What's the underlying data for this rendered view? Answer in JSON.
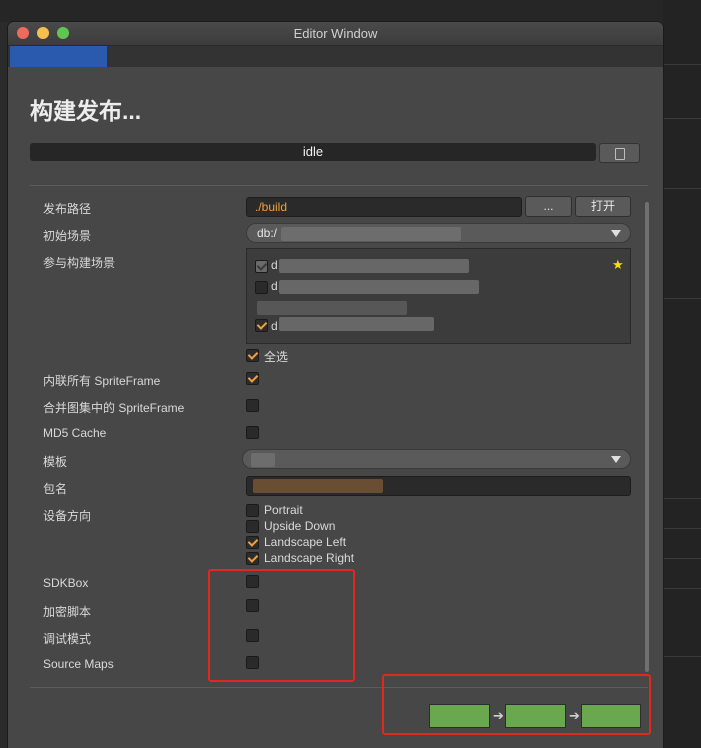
{
  "window": {
    "title": "Editor Window"
  },
  "panel": {
    "heading": "构建发布...",
    "status": "idle"
  },
  "form": {
    "build_path": {
      "label": "发布路径",
      "value": "./build",
      "browse_label": "...",
      "open_label": "打开"
    },
    "start_scene": {
      "label": "初始场景",
      "value": "db:/"
    },
    "included_scenes": {
      "label": "参与构建场景",
      "items": [
        {
          "name": "d",
          "checked": true,
          "disabled": true,
          "starred": true
        },
        {
          "name": "d",
          "checked": false
        },
        {
          "name": "",
          "checked": false
        },
        {
          "name": "d",
          "checked": true
        }
      ],
      "select_all_label": "全选",
      "select_all_checked": true
    },
    "inline_spriteframe": {
      "label": "内联所有 SpriteFrame",
      "checked": true
    },
    "merge_spriteframe": {
      "label": "合并图集中的 SpriteFrame",
      "checked": false
    },
    "md5_cache": {
      "label": "MD5 Cache",
      "checked": false
    },
    "template": {
      "label": "模板",
      "value": ""
    },
    "package_name": {
      "label": "包名",
      "value": ""
    },
    "orientation": {
      "label": "设备方向",
      "options": [
        {
          "label": "Portrait",
          "checked": false
        },
        {
          "label": "Upside Down",
          "checked": false
        },
        {
          "label": "Landscape Left",
          "checked": true
        },
        {
          "label": "Landscape Right",
          "checked": true
        }
      ]
    },
    "sdkbox": {
      "label": "SDKBox",
      "checked": false
    },
    "encrypt_js": {
      "label": "加密脚本",
      "checked": false
    },
    "debug": {
      "label": "调试模式",
      "checked": false
    },
    "source_maps": {
      "label": "Source Maps",
      "checked": false
    }
  },
  "steps": {
    "count": 3,
    "color": "#6aa84f"
  },
  "colors": {
    "accent": "#f0a040",
    "annotation": "#e0281c",
    "tab_active": "#2a5aad"
  }
}
